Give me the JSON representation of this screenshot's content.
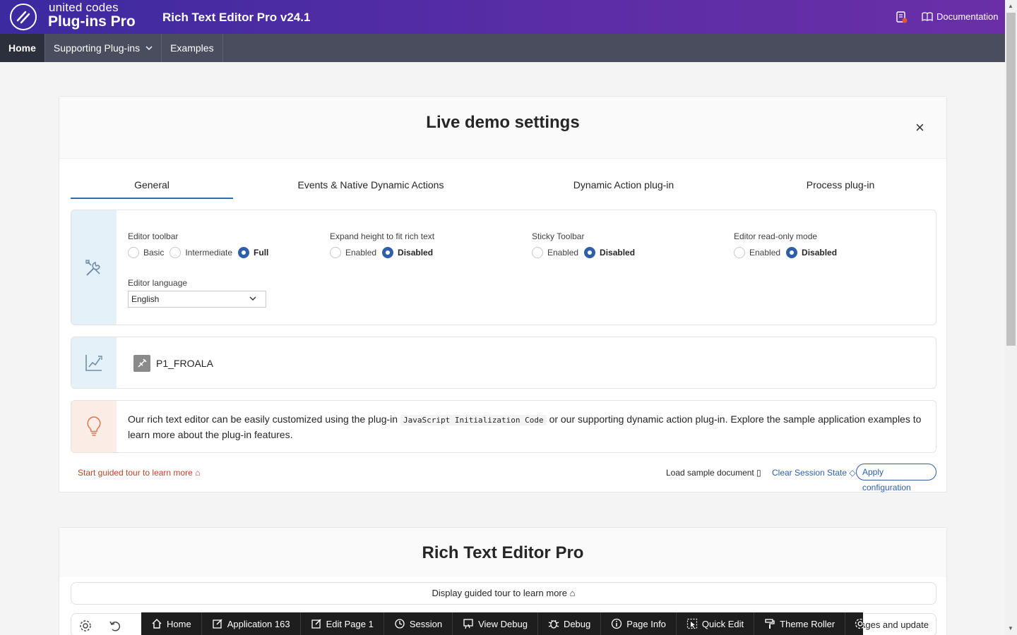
{
  "header": {
    "brand_top": "united codes",
    "brand_bottom": "Plug-ins Pro",
    "app_title": "Rich Text Editor Pro v24.1",
    "documentation": "Documentation"
  },
  "nav": {
    "items": [
      {
        "label": "Home"
      },
      {
        "label": "Supporting Plug-ins"
      },
      {
        "label": "Examples"
      }
    ]
  },
  "settings": {
    "title": "Live demo settings",
    "tabs": [
      {
        "label": "General"
      },
      {
        "label": "Events & Native Dynamic Actions"
      },
      {
        "label": "Dynamic Action plug-in"
      },
      {
        "label": "Process plug-in"
      }
    ],
    "toolbar": {
      "label": "Editor toolbar",
      "options": [
        "Basic",
        "Intermediate",
        "Full"
      ],
      "selected": "Full"
    },
    "expand": {
      "label": "Expand height to fit rich text",
      "options": [
        "Enabled",
        "Disabled"
      ],
      "selected": "Disabled"
    },
    "sticky": {
      "label": "Sticky Toolbar",
      "options": [
        "Enabled",
        "Disabled"
      ],
      "selected": "Disabled"
    },
    "readonly": {
      "label": "Editor read-only mode",
      "options": [
        "Enabled",
        "Disabled"
      ],
      "selected": "Disabled"
    },
    "language": {
      "label": "Editor language",
      "value": "English"
    },
    "item_name": "P1_FROALA",
    "info": {
      "before": "Our rich text editor can be easily customized using the plug-in",
      "code": "JavaScript Initialization Code",
      "after": "or our supporting dynamic action plug-in. Explore the sample application examples to learn more about the plug-in features."
    },
    "footer": {
      "tour": "Start guided tour to learn more",
      "load": "Load sample document",
      "clear": "Clear Session State",
      "apply": "Apply configuration"
    }
  },
  "editor_card": {
    "title": "Rich Text Editor Pro",
    "tour": "Display guided tour to learn more",
    "upload_text": "images and update"
  },
  "devbar": {
    "items": [
      {
        "label": "Home"
      },
      {
        "label": "Application 163"
      },
      {
        "label": "Edit Page 1"
      },
      {
        "label": "Session"
      },
      {
        "label": "View Debug"
      },
      {
        "label": "Debug"
      },
      {
        "label": "Page Info"
      },
      {
        "label": "Quick Edit"
      },
      {
        "label": "Theme Roller"
      }
    ]
  },
  "colors": {
    "header_start": "#3c2aa0",
    "header_end": "#6a2fa7",
    "nav_bg": "#4a4d5e",
    "accent": "#2e5fa8",
    "tour_link": "#c0442b"
  }
}
